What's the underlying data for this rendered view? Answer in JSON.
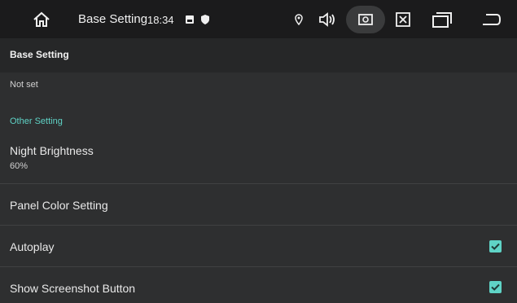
{
  "status_bar": {
    "title": "Base Setting",
    "time": "18:34",
    "icons": [
      "home-icon",
      "image-icon",
      "shield-icon",
      "location-icon",
      "volume-icon",
      "screenshot-icon",
      "close-box-icon",
      "recent-apps-icon",
      "back-icon"
    ]
  },
  "app_bar": {
    "title": "Base Setting"
  },
  "settings": {
    "previous_summary": "Not set",
    "category": "Other Setting",
    "night_brightness": {
      "title": "Night Brightness",
      "summary": "60%"
    },
    "panel_color": {
      "title": "Panel Color Setting"
    },
    "autoplay": {
      "title": "Autoplay",
      "checked": true
    },
    "show_screenshot": {
      "title": "Show Screenshot Button",
      "checked": true
    }
  },
  "colors": {
    "accent": "#5fd3c6",
    "status_bar_bg": "#1b1b1c",
    "app_bar_bg": "#262728",
    "content_bg": "#2e2f30"
  }
}
